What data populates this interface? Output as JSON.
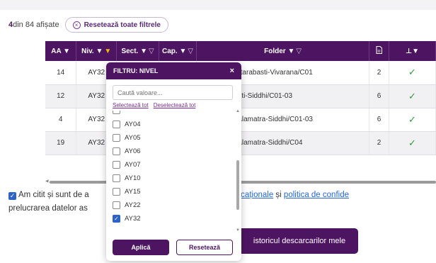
{
  "summary": {
    "count": "4",
    "text": " din 84 afișate"
  },
  "reset_filters_label": "Resetează toate filtrele",
  "table": {
    "headers": [
      {
        "label": "AA ▼",
        "funnel": ""
      },
      {
        "label": "Niv. ▼",
        "funnel": "▼"
      },
      {
        "label": "Sect. ▼",
        "funnel": "▽"
      },
      {
        "label": "Cap. ▼",
        "funnel": "▽"
      },
      {
        "label": "Folder ▼",
        "funnel": "▽"
      },
      {
        "label": "",
        "funnel": ""
      },
      {
        "label": "⊥▼",
        "funnel": ""
      }
    ],
    "rows": [
      {
        "aa": "14",
        "niv": "AY32",
        "folder": "i-Prayoga/Uttarabasti-Vivarana/C01",
        "files": "2",
        "ok": "✓"
      },
      {
        "aa": "12",
        "niv": "AY32",
        "folder": "i-Sthana/Basti-Siddhi/C01-03",
        "files": "6",
        "ok": "✓"
      },
      {
        "aa": "4",
        "niv": "AY32",
        "folder": "i-Sthana/Phalamatra-Siddhi/C01-03",
        "files": "6",
        "ok": "✓"
      },
      {
        "aa": "19",
        "niv": "AY32",
        "folder": "i-Sthana/Phalamatra-Siddhi/C04",
        "files": "2",
        "ok": "✓"
      }
    ]
  },
  "consent": {
    "part1": "Am citit și sunt de a",
    "link1": "materialelor educaționale",
    "and": " și ",
    "link2": "politica de confide",
    "line2": "prelucrarea datelor as"
  },
  "history_button": "istoricul descarcarilor mele",
  "popup": {
    "title": "FILTRU: NIVEL",
    "close": "×",
    "search_placeholder": "Caută valoare...",
    "select_all": "Selectează tot",
    "deselect_all": "Deselectează tot",
    "items": [
      {
        "label": "AY04",
        "checked": false
      },
      {
        "label": "AY05",
        "checked": false
      },
      {
        "label": "AY06",
        "checked": false
      },
      {
        "label": "AY07",
        "checked": false
      },
      {
        "label": "AY10",
        "checked": false
      },
      {
        "label": "AY15",
        "checked": false
      },
      {
        "label": "AY22",
        "checked": false
      },
      {
        "label": "AY32",
        "checked": true
      }
    ],
    "apply": "Aplică",
    "reset": "Resetează"
  }
}
